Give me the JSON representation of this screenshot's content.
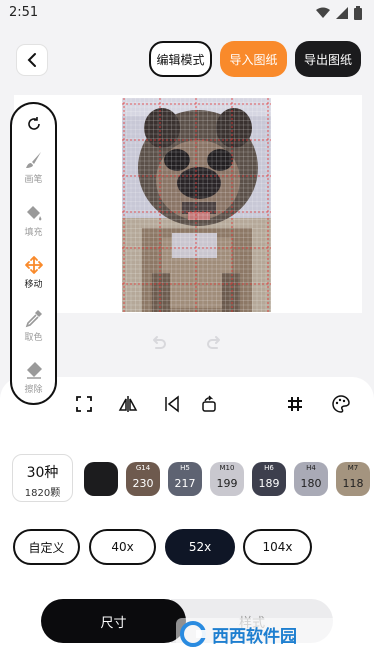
{
  "status": {
    "time": "2:51"
  },
  "header": {
    "edit_mode": "编辑模式",
    "import": "导入图纸",
    "export": "导出图纸"
  },
  "tools": [
    {
      "label": "画笔",
      "icon": "brush-icon"
    },
    {
      "label": "填充",
      "icon": "fill-bucket-icon"
    },
    {
      "label": "移动",
      "icon": "move-icon",
      "active": true
    },
    {
      "label": "取色",
      "icon": "eyedropper-icon"
    },
    {
      "label": "擦除",
      "icon": "eraser-icon"
    }
  ],
  "colors": {
    "accent": "#f98a2b",
    "dark": "#1b1b1d",
    "selected_size": "#0f1626"
  },
  "palette_summary": {
    "count": "30种",
    "beads": "1820颗"
  },
  "swatches": [
    {
      "code": "",
      "value": "",
      "color": "#1c1c1e",
      "text": "#ffffff"
    },
    {
      "code": "G14",
      "value": "230",
      "color": "#6e5a4e",
      "text": "#ffffff"
    },
    {
      "code": "H5",
      "value": "217",
      "color": "#5e6372",
      "text": "#ffffff"
    },
    {
      "code": "M10",
      "value": "199",
      "color": "#c9c8cf",
      "text": "#222222"
    },
    {
      "code": "H6",
      "value": "189",
      "color": "#3d3f4d",
      "text": "#ffffff"
    },
    {
      "code": "H4",
      "value": "180",
      "color": "#a9aab6",
      "text": "#222222"
    },
    {
      "code": "M7",
      "value": "118",
      "color": "#a4947f",
      "text": "#222222"
    }
  ],
  "sizes": [
    {
      "label": "自定义",
      "selected": false
    },
    {
      "label": "40x",
      "selected": false
    },
    {
      "label": "52x",
      "selected": true
    },
    {
      "label": "104x",
      "selected": false
    }
  ],
  "tabs": {
    "size": "尺寸",
    "style": "样式"
  },
  "watermark": "西西软件园"
}
